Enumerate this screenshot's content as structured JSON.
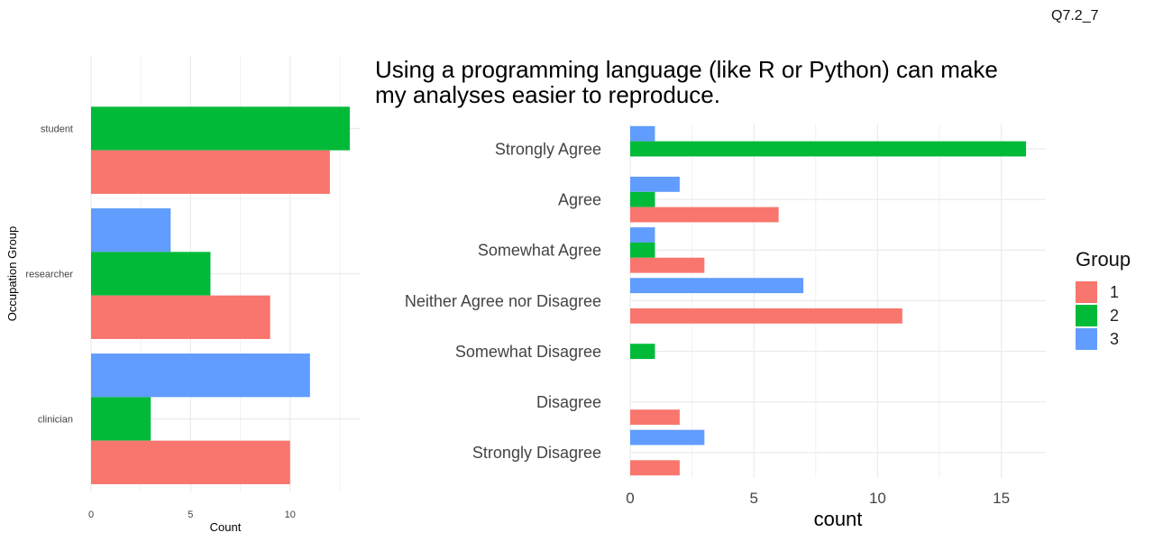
{
  "page_code": "Q7.2_7",
  "colors": {
    "1": "#F8766D",
    "2": "#00BA38",
    "3": "#619CFF"
  },
  "legend": {
    "title": "Group",
    "items": [
      "1",
      "2",
      "3"
    ]
  },
  "chart_data": [
    {
      "type": "bar",
      "orientation": "horizontal",
      "title": "",
      "xlabel": "Count",
      "ylabel": "Occupation Group",
      "categories": [
        "student",
        "researcher",
        "clinician"
      ],
      "series": [
        {
          "name": "1",
          "values": [
            12,
            9,
            10
          ]
        },
        {
          "name": "2",
          "values": [
            13,
            6,
            3
          ]
        },
        {
          "name": "3",
          "values": [
            0,
            4,
            11
          ]
        }
      ],
      "xticks": [
        "0",
        "5",
        "10"
      ],
      "xlim": [
        0,
        13.5
      ],
      "grid": true
    },
    {
      "type": "bar",
      "orientation": "horizontal",
      "title": "Using a programming language (like R or Python) can make my analyses easier to reproduce.",
      "xlabel": "count",
      "ylabel": "",
      "categories": [
        "Strongly Agree",
        "Agree",
        "Somewhat Agree",
        "Neither Agree nor Disagree",
        "Somewhat Disagree",
        "Disagree",
        "Strongly Disagree"
      ],
      "series": [
        {
          "name": "1",
          "values": [
            0,
            6,
            3,
            11,
            0,
            2,
            2
          ]
        },
        {
          "name": "2",
          "values": [
            16,
            1,
            1,
            0,
            1,
            0,
            0
          ]
        },
        {
          "name": "3",
          "values": [
            1,
            2,
            1,
            7,
            0,
            0,
            3
          ]
        }
      ],
      "xticks": [
        "0",
        "5",
        "10",
        "15"
      ],
      "xlim": [
        0,
        16.8
      ],
      "grid": true,
      "legend_position": "right"
    }
  ]
}
